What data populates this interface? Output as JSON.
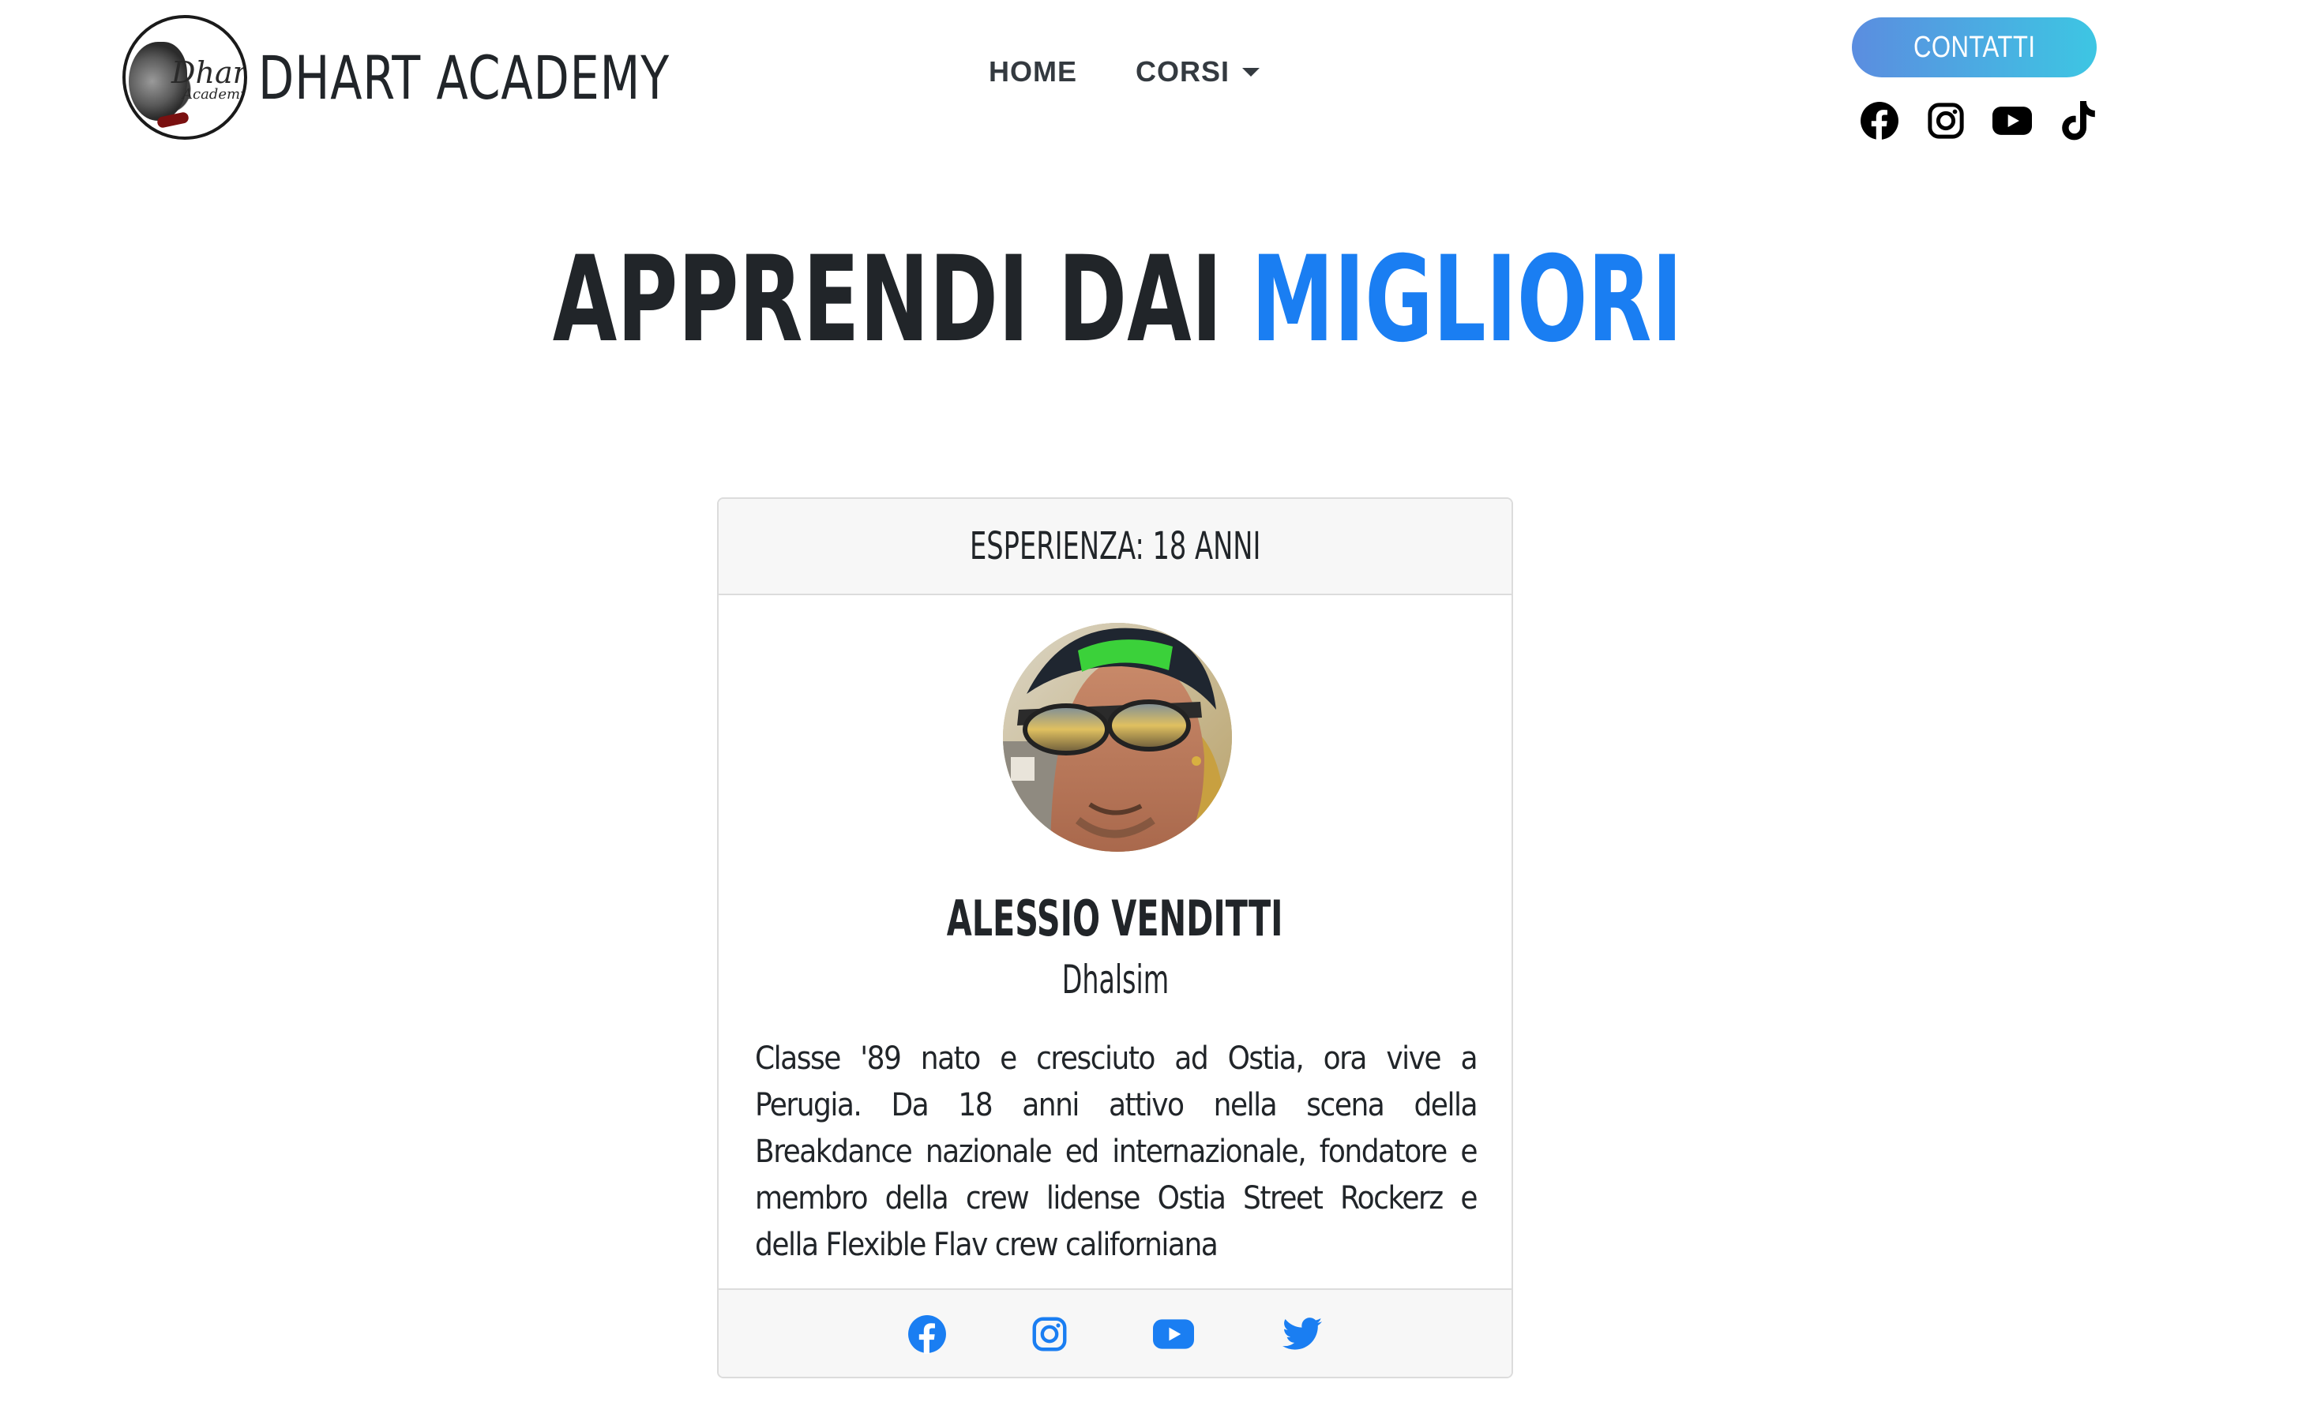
{
  "brand": {
    "name": "DHART ACADEMY",
    "logo_line1": "Dhart",
    "logo_line2": "Academy"
  },
  "nav": {
    "home": "HOME",
    "courses": "CORSI"
  },
  "header_right": {
    "contact_label": "CONTATTI",
    "social_icons": [
      "facebook-icon",
      "instagram-icon",
      "youtube-icon",
      "tiktok-icon"
    ]
  },
  "hero": {
    "title_main": "APPRENDI DAI",
    "title_accent": "MIGLIORI"
  },
  "card": {
    "header": "ESPERIENZA: 18 ANNI",
    "name": "ALESSIO VENDITTI",
    "alias": "Dhalsim",
    "bio": "Classe '89 nato e cresciuto ad Ostia, ora vive a Perugia. Da 18 anni attivo nella scena della Breakdance nazionale ed internazionale, fondatore e membro della crew lidense Ostia Street Rockerz e della Flexible Flav crew californiana",
    "social_icons": [
      "facebook-icon",
      "instagram-icon",
      "youtube-icon",
      "twitter-icon"
    ]
  },
  "colors": {
    "accent": "#1a7ef2",
    "text": "#212529",
    "button_gradient_start": "#5b8de0",
    "button_gradient_end": "#3dc6e3",
    "card_header_bg": "#f7f7f7"
  }
}
